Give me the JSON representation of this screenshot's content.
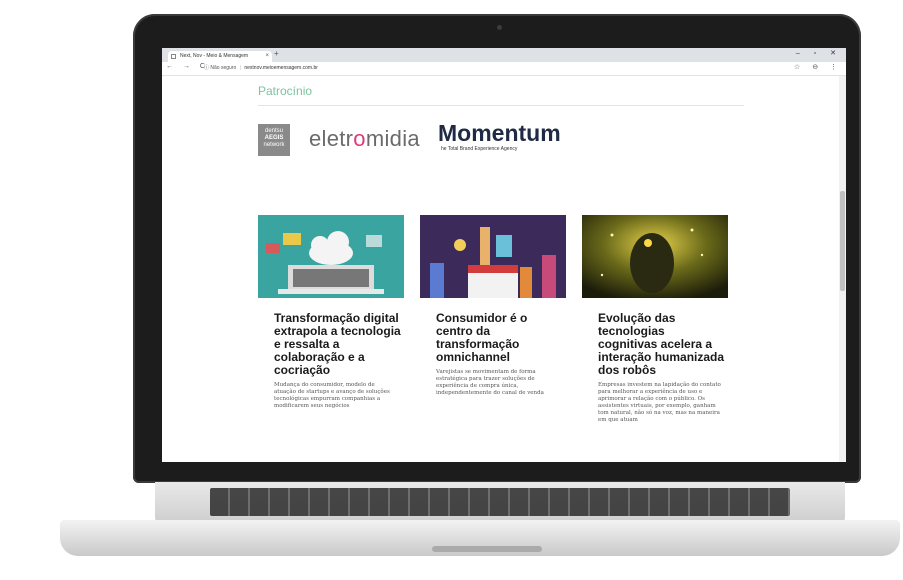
{
  "browser": {
    "tab_title": "Next, Nov - Meio & Mensagem",
    "tab_close": "×",
    "new_tab": "+",
    "window_controls": "– ▫ ✕",
    "nav_buttons": "← → C",
    "security_label": "ⓘ Não seguro",
    "separator": "|",
    "url": "nextnov.meioemensagem.com.br",
    "right_icons": "☆ ⊖ ⋮"
  },
  "sponsors": {
    "title": "Patrocínio",
    "dentsu": {
      "line1": "dentsu",
      "line2": "AEGIS",
      "line3": "network"
    },
    "eletromidia": {
      "before": "eletr",
      "o": "o",
      "after": "midia"
    },
    "momentum": {
      "name": "Momentum",
      "tagline": "he Total Brand Experience Agency"
    }
  },
  "articles": [
    {
      "headline": "Transformação digital extrapola a tecnologia e ressalta a colaboração e a cocriação",
      "summary": "Mudança do consumidor, modelo de atuação de startups e avanço de soluções tecnológicas empurram companhias a modificarem seus negócios"
    },
    {
      "headline": "Consumidor é o centro da transformação omnichannel",
      "summary": "Varejistas se movimentam de forma estratégica para trazer soluções de experiência de compra única, independentemente do canal de venda"
    },
    {
      "headline": "Evolução das tecnologias cognitivas acelera a interação humanizada dos robôs",
      "summary": "Empresas investem na lapidação do contato para melhorar a experiência de uso e aprimorar a relação com o público. Os assistentes virtuais, por exemplo, ganham tom natural, não só na voz, mas na maneira em que atuam"
    }
  ],
  "colors": {
    "accent": "#7cc4a0",
    "card1_bg": "#3aa5a0",
    "card2_bg": "#3b2a5a",
    "card3_bg": "#2a2a10"
  }
}
